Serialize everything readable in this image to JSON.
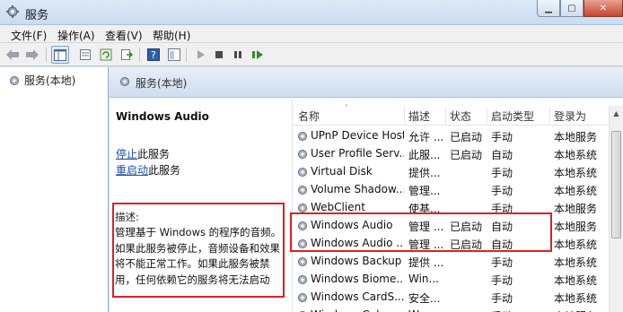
{
  "window": {
    "title": "服务"
  },
  "menu": {
    "items": [
      "文件(F)",
      "操作(A)",
      "查看(V)",
      "帮助(H)"
    ]
  },
  "tree": {
    "item": "服务(本地)"
  },
  "pane_header": "服务(本地)",
  "selected_service": {
    "name": "Windows Audio",
    "action1_link": "停止",
    "action1_rest": "此服务",
    "action2_link": "重启动",
    "action2_rest": "此服务",
    "desc_label": "描述:",
    "description": "管理基于 Windows 的程序的音频。如果此服务被停止，音频设备和效果将不能正常工作。如果此服务被禁用，任何依赖它的服务将无法启动"
  },
  "table": {
    "headers": {
      "name": "名称",
      "desc": "描述",
      "status": "状态",
      "type": "启动类型",
      "logon": "登录为"
    },
    "rows": [
      {
        "name": "UPnP Device Host",
        "desc": "允许 ...",
        "status": "已启动",
        "type": "手动",
        "logon": "本地服务"
      },
      {
        "name": "User Profile Serv...",
        "desc": "此服...",
        "status": "已启动",
        "type": "自动",
        "logon": "本地系统"
      },
      {
        "name": "Virtual Disk",
        "desc": "提供...",
        "status": "",
        "type": "手动",
        "logon": "本地系统"
      },
      {
        "name": "Volume Shadow...",
        "desc": "管理...",
        "status": "",
        "type": "手动",
        "logon": "本地系统"
      },
      {
        "name": "WebClient",
        "desc": "使基...",
        "status": "",
        "type": "手动",
        "logon": "本地服务"
      },
      {
        "name": "Windows Audio",
        "desc": "管理 ...",
        "status": "已启动",
        "type": "自动",
        "logon": "本地服务"
      },
      {
        "name": "Windows Audio ...",
        "desc": "管理 ...",
        "status": "已启动",
        "type": "自动",
        "logon": "本地系统"
      },
      {
        "name": "Windows Backup",
        "desc": "提供 ...",
        "status": "",
        "type": "手动",
        "logon": "本地系统"
      },
      {
        "name": "Windows Biome...",
        "desc": "Win...",
        "status": "",
        "type": "手动",
        "logon": "本地系统"
      },
      {
        "name": "Windows CardS...",
        "desc": "安全...",
        "status": "",
        "type": "手动",
        "logon": "本地系统"
      },
      {
        "name": "Windows Color ...",
        "desc": "Wcs...",
        "status": "",
        "type": "手动",
        "logon": "本地服务"
      }
    ]
  },
  "colors": {
    "highlight_border": "#e02020",
    "link": "#1a4fa8",
    "header_bg": "#cfddef"
  }
}
